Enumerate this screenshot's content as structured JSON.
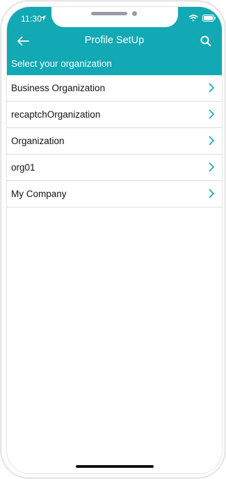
{
  "status_bar": {
    "time": "11:30"
  },
  "header": {
    "title": "Profile SetUp",
    "subtitle": "Select your organization",
    "accent_color": "#12a8b4",
    "back_icon": "arrow-left-icon",
    "search_icon": "search-icon"
  },
  "organizations": [
    {
      "label": "Business Organization",
      "icon": "chevron-right-icon"
    },
    {
      "label": "recaptchOrganization",
      "icon": "chevron-right-icon"
    },
    {
      "label": "Organization",
      "icon": "chevron-right-icon"
    },
    {
      "label": "org01",
      "icon": "chevron-right-icon"
    },
    {
      "label": "My Company",
      "icon": "chevron-right-icon"
    }
  ]
}
